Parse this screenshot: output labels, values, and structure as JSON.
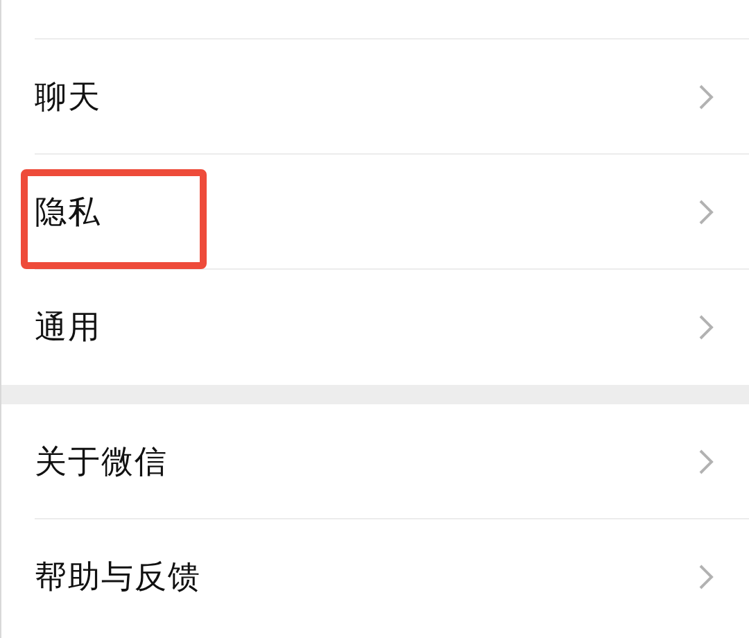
{
  "groups": [
    {
      "items": [
        {
          "label": "聊天",
          "highlighted": false
        },
        {
          "label": "隐私",
          "highlighted": true
        },
        {
          "label": "通用",
          "highlighted": false
        }
      ]
    },
    {
      "items": [
        {
          "label": "关于微信",
          "highlighted": false
        },
        {
          "label": "帮助与反馈",
          "highlighted": false
        }
      ]
    }
  ]
}
